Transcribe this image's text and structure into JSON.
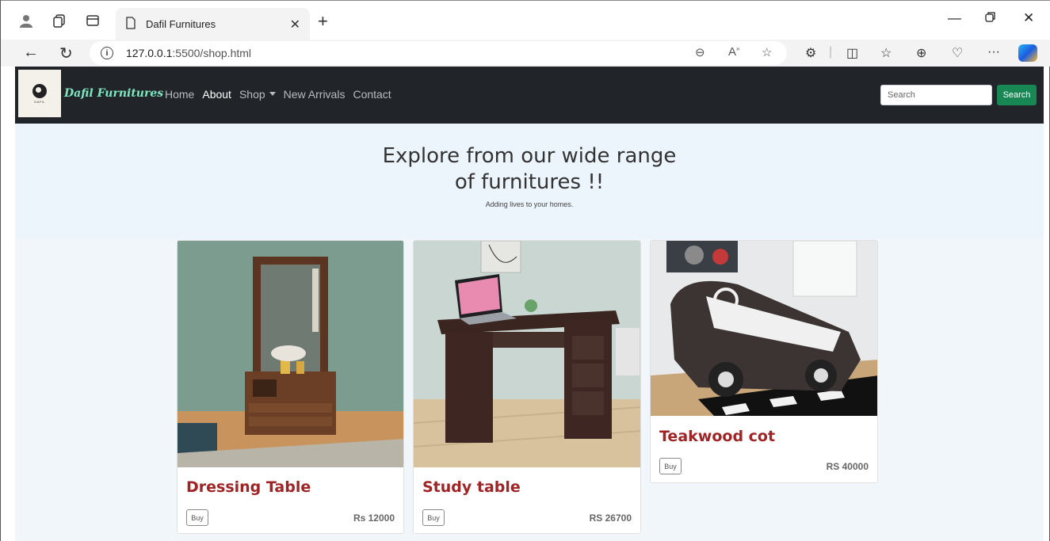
{
  "browser": {
    "tab_title": "Dafil Furnitures",
    "url_host": "127.0.0.1",
    "url_rest": ":5500/shop.html"
  },
  "site": {
    "brand": "Dafil Furnitures",
    "logo_text": "DAFIL",
    "nav": {
      "home": "Home",
      "about": "About",
      "shop": "Shop",
      "new_arrivals": "New Arrivals",
      "contact": "Contact"
    },
    "search": {
      "placeholder": "Search",
      "button": "Search"
    },
    "accent_color": "#198754",
    "title_color": "#a02425"
  },
  "hero": {
    "heading": "Explore from our wide range of furnitures !!",
    "subtitle": "Adding lives to your homes."
  },
  "products": [
    {
      "name": "Dressing Table",
      "price": "Rs 12000",
      "buy": "Buy"
    },
    {
      "name": "Study table",
      "price": "RS 26700",
      "buy": "Buy"
    },
    {
      "name": "Teakwood cot",
      "price": "RS 40000",
      "buy": "Buy"
    }
  ]
}
